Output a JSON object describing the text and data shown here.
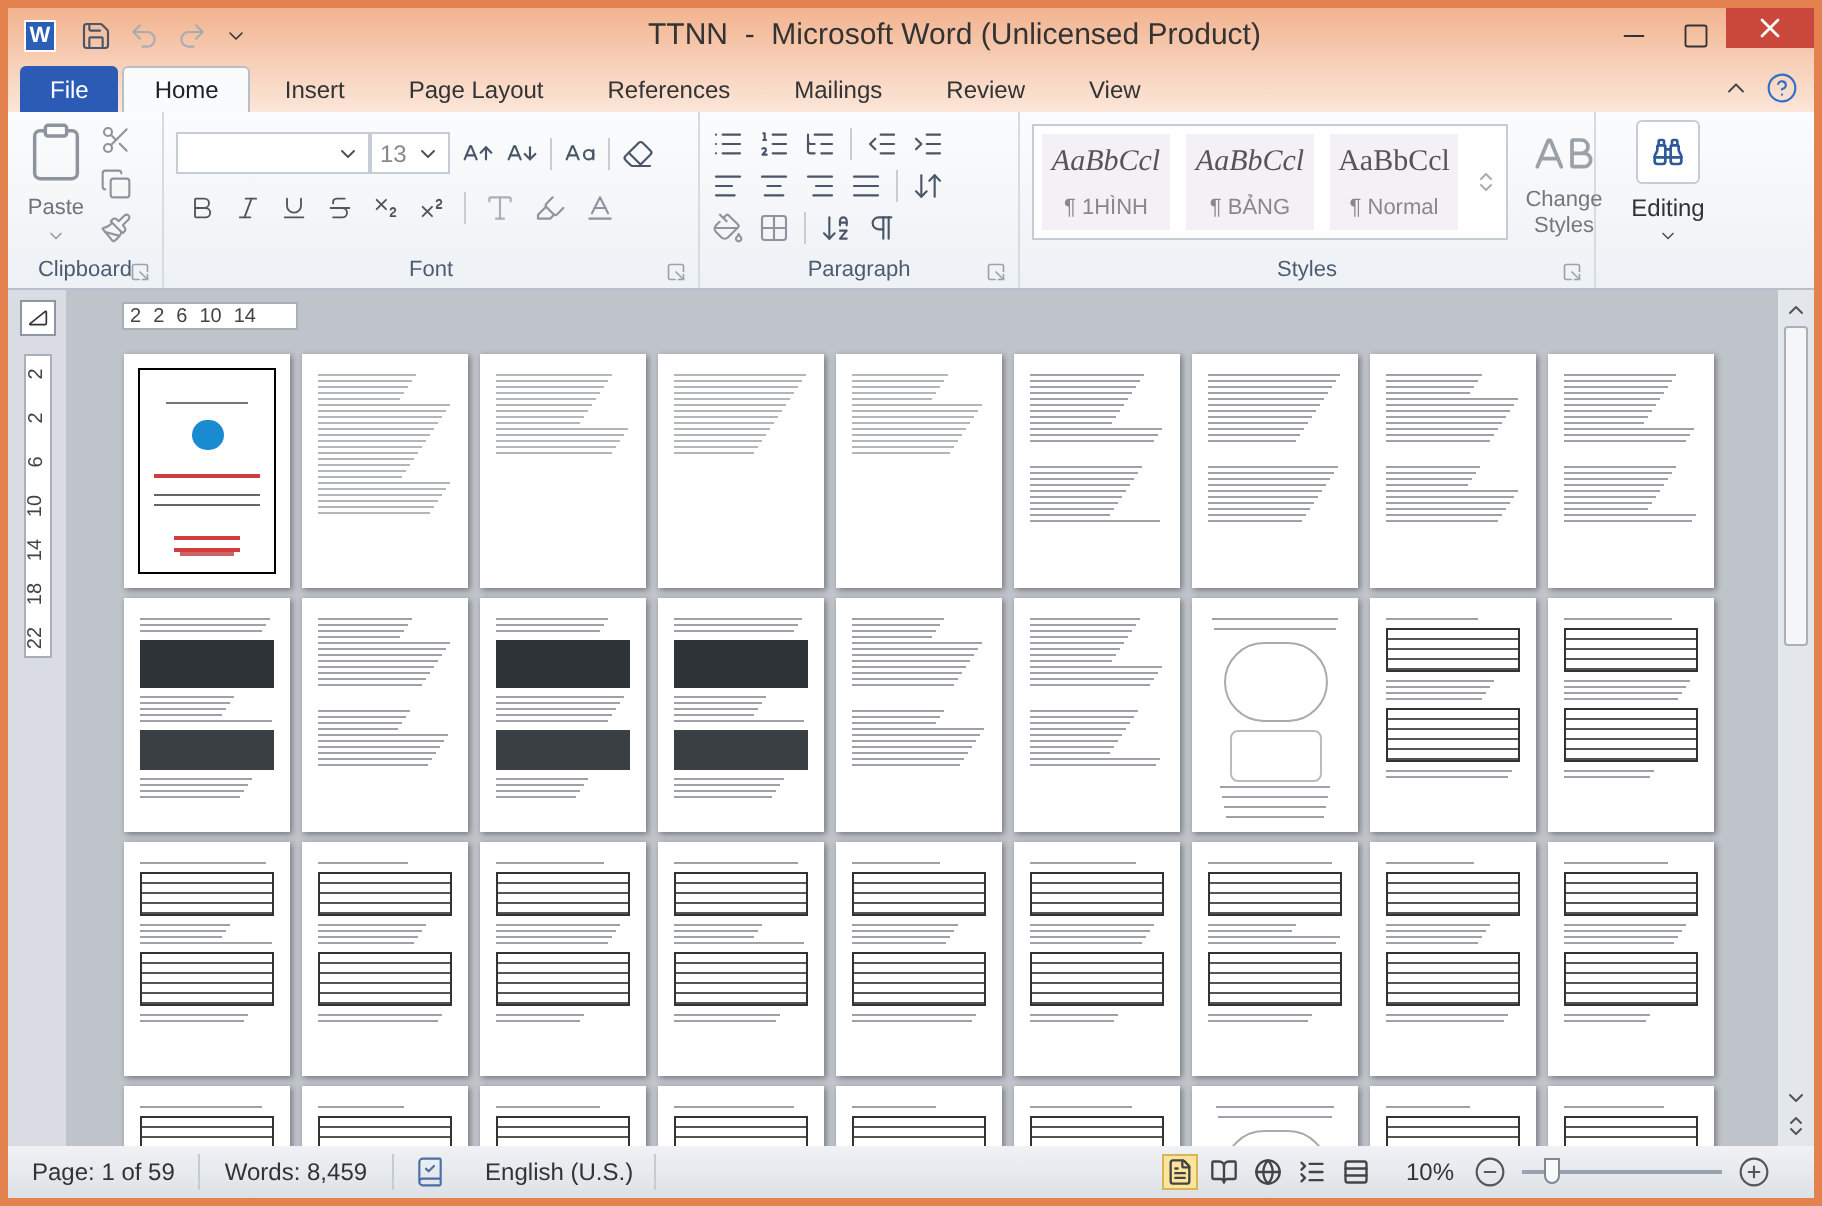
{
  "window": {
    "app_icon_letter": "W",
    "title": "TTNN  -  Microsoft Word (Unlicensed Product)"
  },
  "tabs": [
    {
      "label": "File",
      "kind": "file",
      "selected": false
    },
    {
      "label": "Home",
      "kind": "tab",
      "selected": true
    },
    {
      "label": "Insert",
      "kind": "tab",
      "selected": false
    },
    {
      "label": "Page Layout",
      "kind": "tab",
      "selected": false
    },
    {
      "label": "References",
      "kind": "tab",
      "selected": false
    },
    {
      "label": "Mailings",
      "kind": "tab",
      "selected": false
    },
    {
      "label": "Review",
      "kind": "tab",
      "selected": false
    },
    {
      "label": "View",
      "kind": "tab",
      "selected": false
    }
  ],
  "ribbon": {
    "clipboard": {
      "label": "Clipboard",
      "paste": "Paste"
    },
    "font": {
      "label": "Font",
      "font_size": "13"
    },
    "paragraph": {
      "label": "Paragraph"
    },
    "styles": {
      "label": "Styles",
      "items": [
        {
          "sample": "AaBbCcl",
          "name": "¶ 1HÌNH",
          "italic": true
        },
        {
          "sample": "AaBbCcl",
          "name": "¶ BẢNG",
          "italic": true
        },
        {
          "sample": "AaBbCcl",
          "name": "¶ Normal",
          "italic": false
        }
      ],
      "change_styles": "Change Styles"
    },
    "editing": {
      "label": "Editing"
    }
  },
  "ruler": {
    "horizontal": [
      "2",
      "2",
      "6",
      "10",
      "14"
    ],
    "vertical": [
      "2",
      "2",
      "6",
      "10",
      "14",
      "18",
      "22"
    ]
  },
  "pages": [
    {
      "kind": "cover"
    },
    {
      "kind": "toc"
    },
    {
      "kind": "toc"
    },
    {
      "kind": "toc"
    },
    {
      "kind": "toc"
    },
    {
      "kind": "text"
    },
    {
      "kind": "text"
    },
    {
      "kind": "text"
    },
    {
      "kind": "text"
    },
    {
      "kind": "code"
    },
    {
      "kind": "text"
    },
    {
      "kind": "code"
    },
    {
      "kind": "code"
    },
    {
      "kind": "text"
    },
    {
      "kind": "text"
    },
    {
      "kind": "diagram"
    },
    {
      "kind": "table"
    },
    {
      "kind": "table"
    },
    {
      "kind": "table"
    },
    {
      "kind": "table"
    },
    {
      "kind": "table"
    },
    {
      "kind": "table"
    },
    {
      "kind": "table"
    },
    {
      "kind": "table"
    },
    {
      "kind": "table"
    },
    {
      "kind": "table"
    },
    {
      "kind": "table"
    },
    {
      "kind": "table"
    },
    {
      "kind": "table"
    },
    {
      "kind": "table"
    },
    {
      "kind": "table"
    },
    {
      "kind": "table"
    },
    {
      "kind": "table"
    },
    {
      "kind": "diagram"
    },
    {
      "kind": "table"
    },
    {
      "kind": "table"
    }
  ],
  "status_bar": {
    "page": "Page: 1 of 59",
    "words": "Words: 8,459",
    "language": "English (U.S.)",
    "views": [
      {
        "selected": true
      },
      {
        "selected": false
      },
      {
        "selected": false
      },
      {
        "selected": false
      },
      {
        "selected": false
      }
    ],
    "zoom": "10%",
    "zoom_slider": {
      "level": 0.12
    }
  }
}
